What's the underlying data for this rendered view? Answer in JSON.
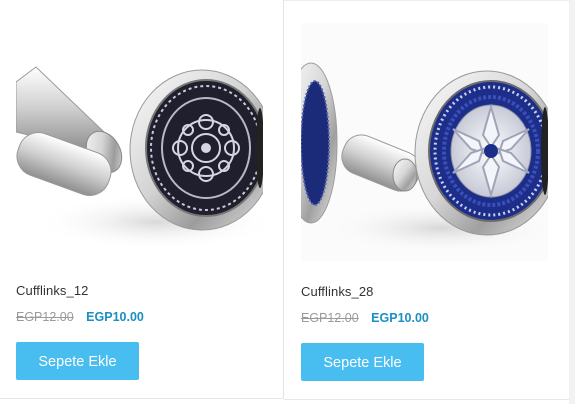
{
  "products": [
    {
      "name": "Cufflinks_12",
      "old_price": "EGP12.00",
      "price": "EGP10.00",
      "button_label": "Sepete Ekle",
      "image": "cufflink-mandala-black-icon"
    },
    {
      "name": "Cufflinks_28",
      "old_price": "EGP12.00",
      "price": "EGP10.00",
      "button_label": "Sepete Ekle",
      "image": "cufflink-blue-sapphire-icon"
    }
  ],
  "colors": {
    "accent_button": "#48bdf0",
    "price": "#1b8fc4",
    "old_price": "#9a9a9a"
  }
}
